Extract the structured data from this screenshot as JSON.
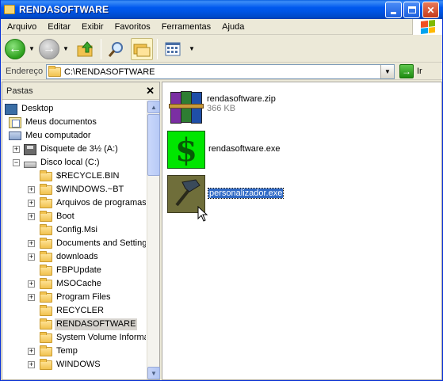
{
  "window": {
    "title": "RENDASOFTWARE"
  },
  "menu": [
    "Arquivo",
    "Editar",
    "Exibir",
    "Favoritos",
    "Ferramentas",
    "Ajuda"
  ],
  "address": {
    "label": "Endereço",
    "value": "C:\\RENDASOFTWARE",
    "go_label": "Ir"
  },
  "folders_pane": {
    "title": "Pastas",
    "items": [
      {
        "label": "Desktop"
      },
      {
        "label": "Meus documentos"
      },
      {
        "label": "Meu computador"
      },
      {
        "label": "Disquete de 3½ (A:)"
      },
      {
        "label": "Disco local (C:)"
      },
      {
        "label": "$RECYCLE.BIN"
      },
      {
        "label": "$WINDOWS.~BT"
      },
      {
        "label": "Arquivos de programas"
      },
      {
        "label": "Boot"
      },
      {
        "label": "Config.Msi"
      },
      {
        "label": "Documents and Settings"
      },
      {
        "label": "downloads"
      },
      {
        "label": "FBPUpdate"
      },
      {
        "label": "MSOCache"
      },
      {
        "label": "Program Files"
      },
      {
        "label": "RECYCLER"
      },
      {
        "label": "RENDASOFTWARE"
      },
      {
        "label": "System Volume Information"
      },
      {
        "label": "Temp"
      },
      {
        "label": "WINDOWS"
      }
    ]
  },
  "files": [
    {
      "name": "rendasoftware.zip",
      "size": "366 KB"
    },
    {
      "name": "rendasoftware.exe"
    },
    {
      "name": "personalizador.exe"
    }
  ],
  "colors": {
    "titlebar": "#0058ee",
    "selection": "#316ac5",
    "dollar_bg": "#00e600"
  }
}
